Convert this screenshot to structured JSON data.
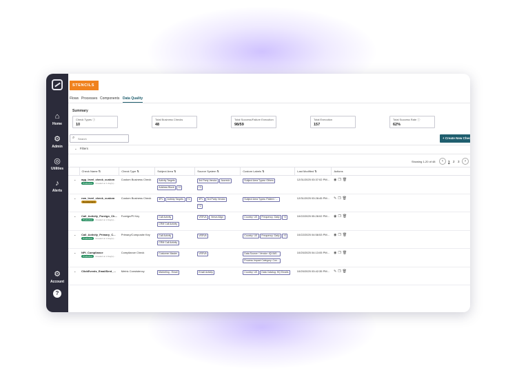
{
  "app": {
    "brand": "STENCILS",
    "tabs": [
      "Flows",
      "Processes",
      "Components",
      "Data Quality"
    ],
    "active_tab": "Data Quality"
  },
  "sidebar": {
    "items": [
      {
        "label": "Home",
        "icon": "home-icon"
      },
      {
        "label": "Admin",
        "icon": "gear-icon"
      },
      {
        "label": "Utilities",
        "icon": "utilities-icon"
      },
      {
        "label": "Alerts",
        "icon": "bell-icon"
      },
      {
        "label": "Account",
        "icon": "gear-icon"
      }
    ],
    "help": "?"
  },
  "summary": {
    "title": "Summary",
    "cards": [
      {
        "label": "Check Types ⓘ",
        "value": "10"
      },
      {
        "label": "Total Business Checks",
        "value": "48"
      },
      {
        "label": "Total Success/Failure Execution",
        "value": "98/59"
      },
      {
        "label": "Total Execution",
        "value": "157"
      },
      {
        "label": "Total Success Rate ⓘ",
        "value": "62%"
      }
    ]
  },
  "actions": {
    "create_label": "+ Create New Check"
  },
  "search": {
    "placeholder": "Search",
    "value": ""
  },
  "filters": {
    "label": "Filters"
  },
  "pagination": {
    "showing": "Showing 1-20 of 48",
    "pages": [
      "1",
      "2",
      "3"
    ],
    "current": "1"
  },
  "table": {
    "columns": [
      "Check Name ⇅",
      "Check Type ⇅",
      "Subject Area ⇅",
      "Source System ⇅",
      "Custom Labels ⇅",
      "Last Modified ⇅",
      "Actions"
    ],
    "rows": [
      {
        "name": "agg_level_check_custom",
        "badge": "Production",
        "badge_color": "green",
        "note": "Created on 1 day(s)...",
        "type": "Custom Business Check",
        "subject": [
          "Activity Targets",
          "Address Block",
          "+2"
        ],
        "source": [
          "3rd Party Vendor",
          "Accredo",
          "+3"
        ],
        "labels": [
          "Subject Area Types::Others"
        ],
        "modified": "12/31/2025 03:37:02 PM...",
        "actions": [
          "view-icon",
          "copy-icon",
          "delete-icon"
        ]
      },
      {
        "name": "row_level_check_custom",
        "badge": "Development",
        "badge_color": "orange",
        "note": "",
        "type": "Custom Business Check",
        "subject": [
          "3PL",
          "Activity Targets",
          "+1"
        ],
        "source": [
          "3PL",
          "3rd Party Vendor",
          "+2"
        ],
        "labels": [
          "Subject Area Types::Patient / ..."
        ],
        "modified": "12/31/2025 03:28:45 PM...",
        "actions": [
          "edit-icon",
          "copy-icon",
          "delete-icon"
        ]
      },
      {
        "name": "Call_Activity_Foreign_Ch...",
        "badge": "Production",
        "badge_color": "green",
        "note": "Created on 2 day(s)...",
        "type": "Foreign/PI Key",
        "subject": [
          "Call Activity",
          "CRM Call Activity"
        ],
        "source": [
          "VEEVA",
          "Veeva Align"
        ],
        "labels": [
          "Country: US",
          "Frequency: Daily",
          "+2"
        ],
        "modified": "10/22/2025 05:28:02 PM...",
        "actions": [
          "view-icon",
          "copy-icon",
          "delete-icon"
        ]
      },
      {
        "name": "Call_Activity_Primary_C...",
        "badge": "Production",
        "badge_color": "green",
        "note": "Created on 2 day(s)...",
        "type": "Primary/Composite Key",
        "subject": [
          "Call Activity",
          "CRM Call Activity"
        ],
        "source": [
          "VEEVA"
        ],
        "labels": [
          "Country: US",
          "Frequency: Daily",
          "+2"
        ],
        "modified": "10/22/2025 04:58:53 PM...",
        "actions": [
          "view-icon",
          "copy-icon",
          "delete-icon"
        ]
      },
      {
        "name": "NPI_Compliance",
        "badge": "Production",
        "badge_color": "green",
        "note": "Created on 2 day(s)...",
        "type": "Compliance Check",
        "subject": [
          "Customer Master"
        ],
        "source": [
          "VEEVA"
        ],
        "labels": [
          "Data Source / Vendor: IQVIAS...",
          "Process Impact Category: Cus..."
        ],
        "modified": "10/20/2025 04:13:05 PM...",
        "actions": [
          "view-icon",
          "copy-icon",
          "delete-icon"
        ]
      },
      {
        "name": "ClickEvents_EmailSent_...",
        "badge": "",
        "badge_color": "",
        "note": "",
        "type": "Metric Consistency",
        "subject": [
          "Marketing - Email"
        ],
        "source": [
          "Email Activity"
        ],
        "labels": [
          "Country: US",
          "Data Catalog: HQ Emails"
        ],
        "modified": "10/20/2025 03:42:35 PM...",
        "actions": [
          "edit-icon",
          "copy-icon",
          "delete-icon"
        ]
      }
    ]
  }
}
